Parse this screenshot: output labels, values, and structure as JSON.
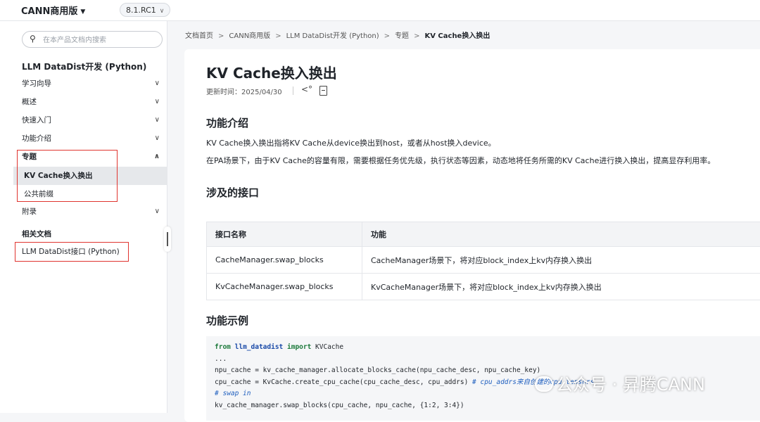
{
  "header": {
    "product": "CANN商用版",
    "version": "8.1.RC1"
  },
  "sidebar": {
    "search_placeholder": "在本产品文档内搜索",
    "title": "LLM DataDist开发 (Python)",
    "items": [
      {
        "label": "学习向导"
      },
      {
        "label": "概述"
      },
      {
        "label": "快速入门"
      },
      {
        "label": "功能介绍"
      },
      {
        "label": "专题",
        "expanded": true
      },
      {
        "label": "附录"
      }
    ],
    "sub_items": [
      {
        "label": "KV Cache换入换出",
        "active": true
      },
      {
        "label": "公共前缀"
      }
    ],
    "related_title": "相关文档",
    "related_link": "LLM DataDist接口 (Python)"
  },
  "breadcrumb": [
    "文档首页",
    "CANN商用版",
    "LLM DataDist开发 (Python)",
    "专题",
    "KV Cache换入换出"
  ],
  "article": {
    "title": "KV Cache换入换出",
    "updated": "更新时间：2025/04/30",
    "section1": "功能介绍",
    "para1": "KV Cache换入换出指将KV Cache从device换出到host，或者从host换入device。",
    "para2": "在PA场景下，由于KV Cache的容量有限，需要根据任务优先级，执行状态等因素，动态地将任务所需的KV Cache进行换入换出，提高显存利用率。",
    "section2": "涉及的接口",
    "table": {
      "headers": [
        "接口名称",
        "功能"
      ],
      "rows": [
        [
          "CacheManager.swap_blocks",
          "CacheManager场景下，将对应block_index上kv内存换入换出"
        ],
        [
          "KvCacheManager.swap_blocks",
          "KvCacheManager场景下，将对应block_index上kv内存换入换出"
        ]
      ]
    },
    "section3": "功能示例",
    "code": {
      "l1_from": "from",
      "l1_mod": "llm_datadist",
      "l1_import": "import",
      "l1_rest": " KVCache",
      "l2": "...",
      "l3": "npu_cache = kv_cache_manager.allocate_blocks_cache(npu_cache_desc, npu_cache_key)",
      "l4_code": "cpu_cache = KvCache.create_cpu_cache(cpu_cache_desc, cpu_addrs) ",
      "l4_comment": "# cpu_addrs来自创建的cpu tensors",
      "l5": "# swap in",
      "l6": "kv_cache_manager.swap_blocks(cpu_cache, npu_cache, {1:2, 3:4})"
    }
  },
  "watermark": "公众号 · 昇腾CANN",
  "colors": {
    "highlight": "#e0342f",
    "active_bg": "#e6e8eb",
    "keyword": "#1d7a3c",
    "comment": "#1f5fbf"
  }
}
